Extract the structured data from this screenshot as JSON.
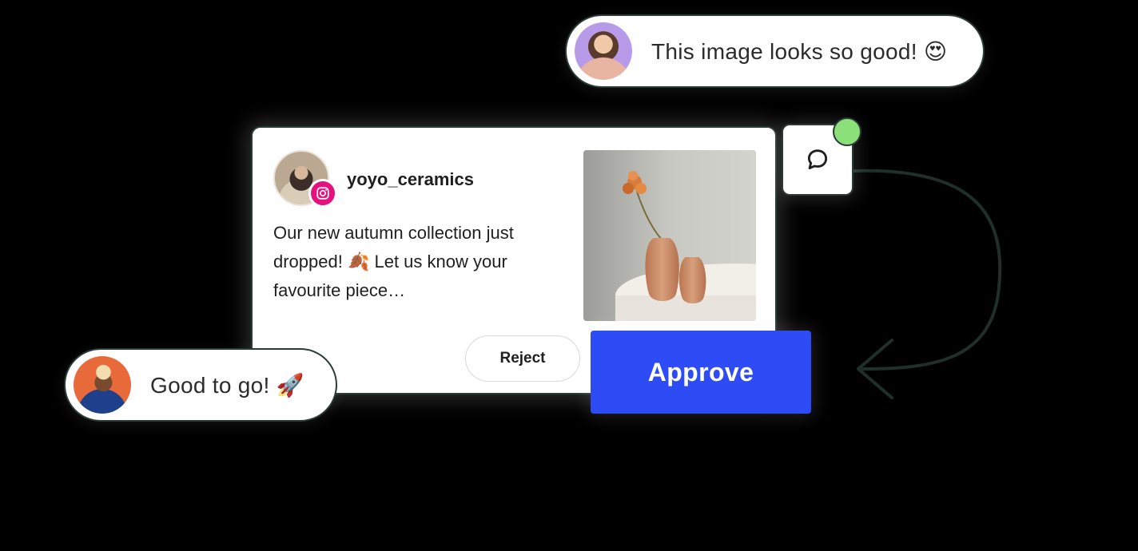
{
  "comments": {
    "top": {
      "text": "This image looks so good! 😍"
    },
    "bottom": {
      "text": "Good to go! 🚀"
    }
  },
  "post": {
    "username": "yoyo_ceramics",
    "network_icon": "instagram-icon",
    "caption": "Our new autumn collection just dropped! 🍂 Let us know your favourite piece…",
    "reject_label": "Reject"
  },
  "actions": {
    "approve_label": "Approve"
  },
  "icons": {
    "comment": "comment-icon",
    "notification": "notification-dot"
  },
  "colors": {
    "approve": "#2e4cf5",
    "instagram": "#e4117f",
    "notify": "#8be07a"
  }
}
